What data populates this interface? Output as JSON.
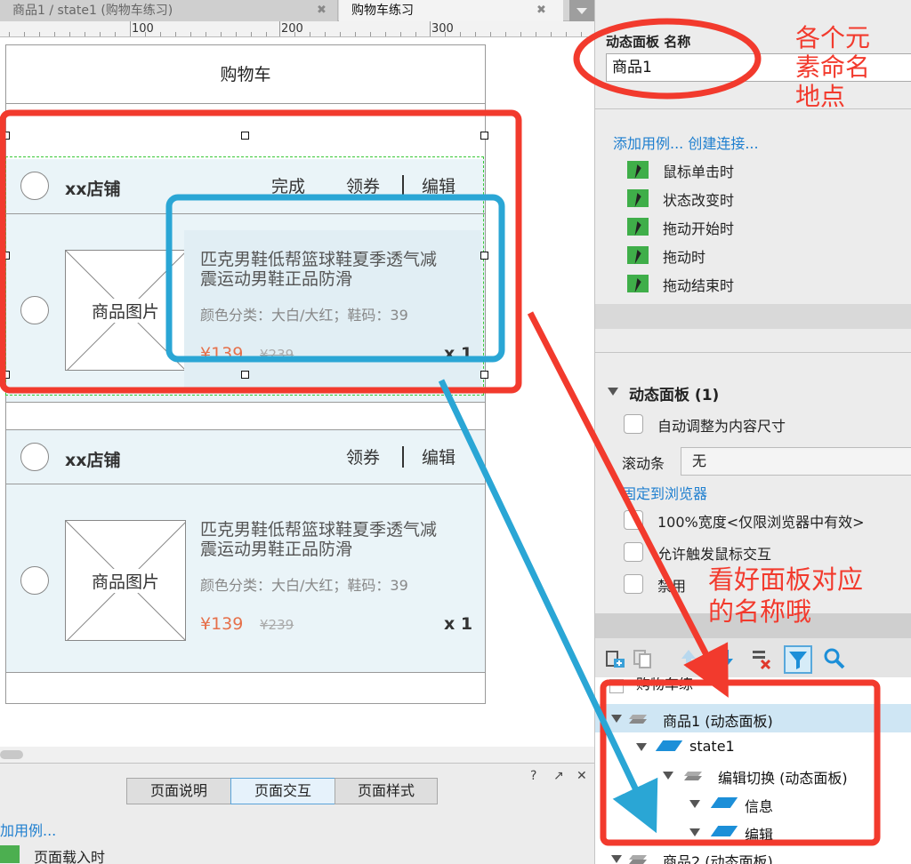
{
  "tabs": [
    {
      "label": "商品1 / state1 (购物车练习)",
      "close": "✖"
    },
    {
      "label": "购物车练习",
      "close": "✖"
    }
  ],
  "ruler": {
    "labels": [
      "100",
      "200",
      "300"
    ]
  },
  "canvas": {
    "cart_title": "购物车",
    "shop1": {
      "name": "xx店铺",
      "done": "完成",
      "coupon": "领券",
      "edit": "编辑"
    },
    "shop2": {
      "name": "xx店铺",
      "coupon": "领券",
      "edit": "编辑"
    },
    "product": {
      "image_label": "商品图片",
      "title_line1": "匹克男鞋低帮篮球鞋夏季透气减",
      "title_line2": "震运动男鞋正品防滑",
      "spec": "颜色分类：大白/大红；鞋码：39",
      "price": "¥139",
      "old_price": "¥239",
      "qty": "x 1"
    }
  },
  "bottom_panel": {
    "tabs": [
      "页面说明",
      "页面交互",
      "页面样式"
    ],
    "active_tab": "页面交互",
    "icons": [
      "?",
      "↗",
      "✕"
    ],
    "add_usecase": "加用例...",
    "event": "页面载入时"
  },
  "right_panel": {
    "name_label": "动态面板 名称",
    "name_value": "商品1",
    "add_links": "添加用例...  创建连接...",
    "events": [
      "鼠标单击时",
      "状态改变时",
      "拖动开始时",
      "拖动时",
      "拖动结束时"
    ],
    "dp_section": "动态面板 (1)",
    "auto_size": "自动调整为内容尺寸",
    "scroll_label": "滚动条",
    "scroll_value": "无",
    "pin": "固定到浏览器",
    "width100": "100%宽度<仅限浏览器中有效>",
    "touch": "允许触发鼠标交互",
    "disable": "禁用"
  },
  "tree": {
    "rows": [
      {
        "label": "购物车练"
      },
      {
        "label": "商品1 (动态面板)"
      },
      {
        "label": "state1"
      },
      {
        "label": "编辑切换 (动态面板)"
      },
      {
        "label": "信息"
      },
      {
        "label": "编辑"
      },
      {
        "label": "商品2 (动态面板)"
      }
    ]
  },
  "annotations": {
    "top_note": [
      "各个元",
      "素命名",
      "地点"
    ],
    "middle_note": [
      "看好面板对应",
      "的名称哦"
    ],
    "color": "#f23a2d",
    "blue": "#2aa6d5"
  }
}
